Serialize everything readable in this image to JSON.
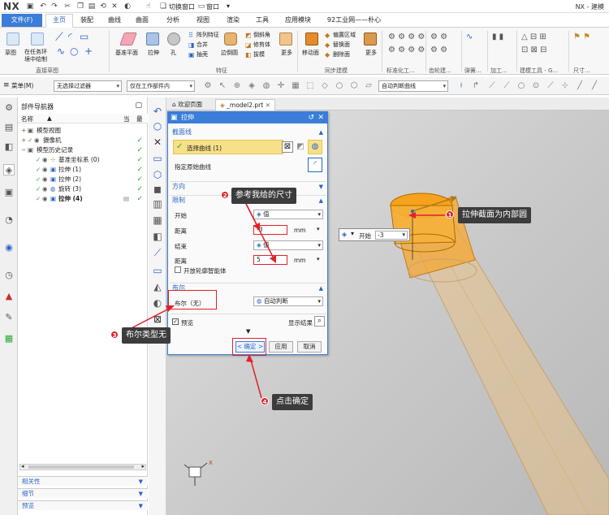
{
  "titlebar": {
    "logo": "NX",
    "switch_window": "切换窗口",
    "window_menu": "窗口",
    "title": "NX - 建模"
  },
  "tabs": [
    "文件(F)",
    "主页",
    "装配",
    "曲线",
    "曲面",
    "分析",
    "视图",
    "渲染",
    "工具",
    "应用模块",
    "92工业网——朴心"
  ],
  "ribbon": {
    "sketch": "草图",
    "sketch_in_task": "在任务环境中绘制",
    "group_direct_sketch": "直接草图",
    "datum_plane": "基准平面",
    "extrude": "拉伸",
    "hole": "孔",
    "pattern_feature": "阵列特征",
    "unite": "合并",
    "shell": "抽壳",
    "edge_blend": "边倒圆",
    "chamfer": "倒斜角",
    "trim_body": "修剪体",
    "draft": "拔模",
    "group_feature": "特征",
    "more1": "更多",
    "move_face": "移动面",
    "offset_region": "偏置区域",
    "replace_face": "替换面",
    "delete_face": "删除面",
    "group_sync": "同步建模",
    "more2": "更多",
    "group_std": "标准化工...",
    "group_gear": "齿轮建...",
    "group_spring": "弹簧...",
    "group_machine": "加工...",
    "group_build": "建模工具 - G...",
    "group_size": "尺寸..."
  },
  "toolbar2": {
    "menu": "菜单(M)",
    "filter": "无选择过滤器",
    "scope": "仅在工作部件内",
    "snap": "自动判断曲线"
  },
  "navigator": {
    "title": "部件导航器",
    "col_name": "名称",
    "col_current": "当",
    "col_latest": "最",
    "items": [
      {
        "label": "模型视图",
        "check": ""
      },
      {
        "label": "摄像机",
        "check": "✓"
      },
      {
        "label": "模型历史记录",
        "check": "✓"
      },
      {
        "label": "基准坐标系 (0)",
        "check": "✓"
      },
      {
        "label": "拉伸 (1)",
        "check": "✓"
      },
      {
        "label": "拉伸 (2)",
        "check": "✓"
      },
      {
        "label": "旋转 (3)",
        "check": "✓"
      },
      {
        "label": "拉伸 (4)",
        "check": "✓"
      }
    ],
    "accordion": [
      "相关性",
      "细节",
      "预览"
    ]
  },
  "doc_tabs": {
    "welcome": "欢迎页面",
    "model": "_model2.prt"
  },
  "dialog": {
    "title": "拉伸",
    "section_curve": "截面线",
    "select_curve": "选择曲线 (1)",
    "specify_origin_curve": "指定原始曲线",
    "section_direction": "方向",
    "section_limits": "限制",
    "start_label": "开始",
    "start_value": "值",
    "distance_label1": "距离",
    "distance_value1": "-3",
    "unit1": "mm",
    "end_label": "结束",
    "end_value": "值",
    "distance_label2": "距离",
    "distance_value2": "5",
    "unit2": "mm",
    "open_profile": "开放轮廓智能体",
    "section_boolean": "布尔",
    "boolean_label": "布尔（无）",
    "boolean_value": "自动判断",
    "preview_label": "预览",
    "show_result": "显示结果",
    "ok_button": "< 确定 >",
    "apply_button": "应用",
    "cancel_button": "取消"
  },
  "canvas_dim": {
    "start_label": "开始",
    "value": "-3"
  },
  "annotations": [
    {
      "num": "1",
      "text": "拉伸截面为内部圆"
    },
    {
      "num": "2",
      "text": "参考我给的尺寸"
    },
    {
      "num": "3",
      "text": "布尔类型无"
    },
    {
      "num": "4",
      "text": "点击确定"
    }
  ],
  "colors": {
    "accent": "#3b7dd8",
    "annotation_red": "#e0222a",
    "annotation_box": "#3c3c3c",
    "check_green": "#2aa832",
    "section_yellow": "#f7e08a",
    "cylinder_orange": "#f0a020"
  }
}
